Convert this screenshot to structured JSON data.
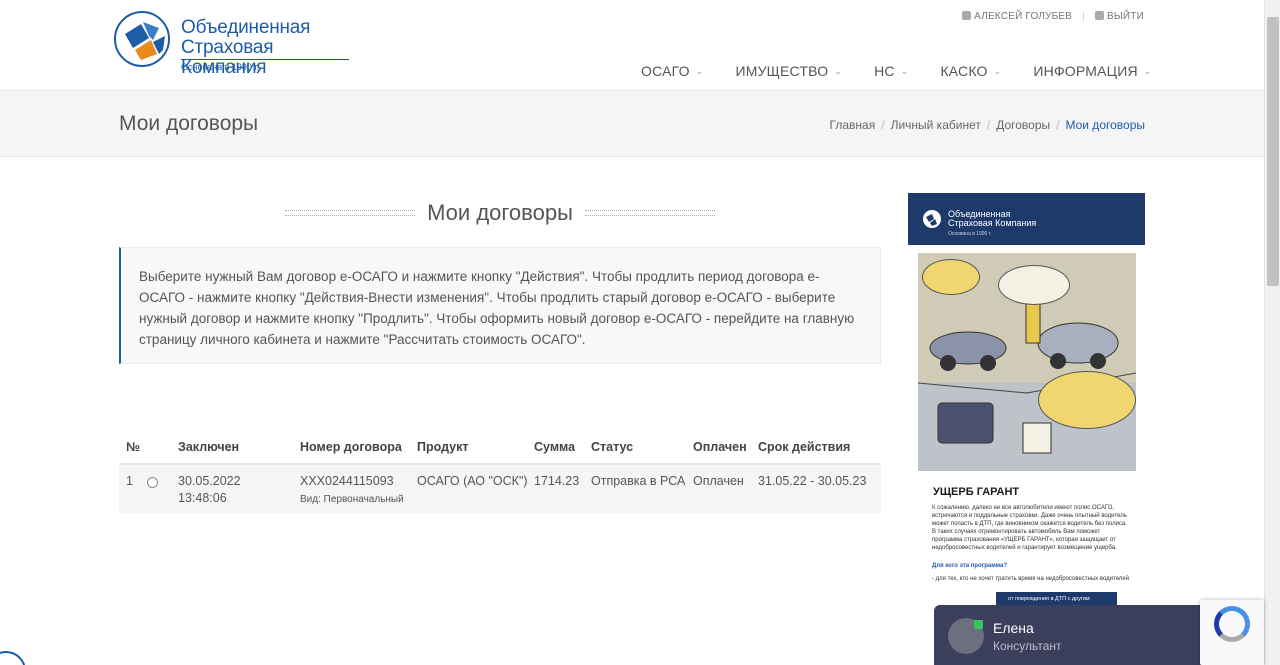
{
  "header": {
    "logo_line1": "Объединенная",
    "logo_line2": "Страховая Компания",
    "logo_sub": "Основана в 1990 г.",
    "user_name": "АЛЕКСЕЙ ГОЛУБЕВ",
    "logout_label": "ВЫЙТИ",
    "nav": [
      "ОСАГО",
      "ИМУЩЕСТВО",
      "НС",
      "КАСКО",
      "ИНФОРМАЦИЯ"
    ]
  },
  "titlebar": {
    "title": "Мои договоры",
    "breadcrumb": [
      "Главная",
      "Личный кабинет",
      "Договоры",
      "Мои договоры"
    ]
  },
  "main": {
    "section_title": "Мои договоры",
    "info_text": "Выберите нужный Вам договор е-ОСАГО и нажмите кнопку \"Действия\". Чтобы продлить период договора е-ОСАГО - нажмите кнопку \"Действия-Внести изменения\". Чтобы продлить старый договор е-ОСАГО - выберите нужный договор и нажмите кнопку \"Продлить\". Чтобы оформить новый договор е-ОСАГО - перейдите на главную страницу личного кабинета и нажмите \"Рассчитать стоимость ОСАГО\".",
    "table": {
      "headers": [
        "№",
        "",
        "Заключен",
        "Номер договора",
        "Продукт",
        "Сумма",
        "Статус",
        "Оплачен",
        "Срок действия"
      ],
      "rows": [
        {
          "num": "1",
          "date": "30.05.2022",
          "time": "13:48:06",
          "contract_number": "XXX0244115093",
          "contract_type": "Вид: Первоначальный",
          "product": "ОСАГО (АО \"ОСК\")",
          "amount": "1714.23",
          "status": "Отправка в РСА",
          "paid": "Оплачен",
          "term": "31.05.22 - 30.05.23"
        }
      ]
    }
  },
  "banner": {
    "logo_line1": "Объединенная",
    "logo_line2": "Страховая Компания",
    "logo_sub": "Основана в 1990 г.",
    "title": "УЩЕРБ ГАРАНТ",
    "text": "К сожалению, далеко не все автолюбители имеют полис ОСАГО, встречаются и поддельные страховки. Даже очень опытный водитель может попасть в ДТП, где виновником окажется водитель без полиса. В таких случаях отремонтировать автомобиль Вам поможет программа страхования «УЩЕРБ ГАРАНТ», которая защищает от недобросовестных водителей и гарантирует возмещение ущерба.",
    "question": "Для кого эта программа?",
    "answer": "- для тех, кто не хочет тратить время на недобросовестных водителей",
    "button_text": "от повреждения в ДТП с другим"
  },
  "chat": {
    "name": "Елена",
    "role": "Консультант"
  },
  "colors": {
    "brand_blue": "#1e5ca8",
    "banner_navy": "#1d3a6b",
    "chat_bg": "#3b3f5c",
    "online": "#35c759"
  }
}
